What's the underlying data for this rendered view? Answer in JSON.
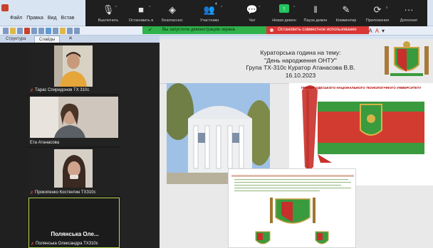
{
  "app": {
    "menu": [
      "Файл",
      "Правка",
      "Вид",
      "Встав"
    ],
    "tabs": [
      "Структура",
      "Слайды"
    ]
  },
  "zoom_toolbar": {
    "items": [
      {
        "label": "Выключить",
        "icon": "microphone-icon"
      },
      {
        "label": "Остановить в",
        "icon": "video-camera-icon"
      },
      {
        "label": "Безопаснос",
        "icon": "shield-icon"
      },
      {
        "label": "Участники",
        "icon": "participants-icon",
        "badge": "4"
      },
      {
        "label": "Чат",
        "icon": "chat-icon"
      },
      {
        "label": "Новая демон",
        "icon": "share-screen-icon"
      },
      {
        "label": "Пауза демон",
        "icon": "pause-icon"
      },
      {
        "label": "Комментир",
        "icon": "pen-icon"
      },
      {
        "label": "Приложения",
        "icon": "apps-icon"
      },
      {
        "label": "Дополнит",
        "icon": "more-icon"
      }
    ]
  },
  "share_banner": {
    "text": "Вы запустили демонстрацию экрана",
    "stop_label": "Остановить совместное использование"
  },
  "participants": [
    {
      "name": "Тарас Спиридонов ТХ 310с",
      "muted": true
    },
    {
      "name": "Ета Атанасова",
      "muted": false
    },
    {
      "name": "Прокопенко Костянтин ТХ310с",
      "muted": true
    },
    {
      "name": "Полянська Олександра ТХ310с",
      "display": "Полянська Оле...",
      "muted": true
    }
  ],
  "slide": {
    "title_lines": [
      "Кураторська година на тему:",
      "\"День народження ОНТУ\"",
      "Група ТХ-310с Куратор Атанасова В.В.",
      "16.10.2023"
    ],
    "banner_caption": "ПРАПОР ОДЕСЬКОГО НАЦІОНАЛЬНОГО ТЕХНОЛОГІЧНОГО УНІВЕРСИТЕТУ"
  },
  "colors": {
    "share_green": "#2fb24a",
    "stop_red": "#d93636",
    "active_speaker": "#b6d94e",
    "flag_green": "#3a9a3e",
    "flag_red": "#c8302b"
  }
}
